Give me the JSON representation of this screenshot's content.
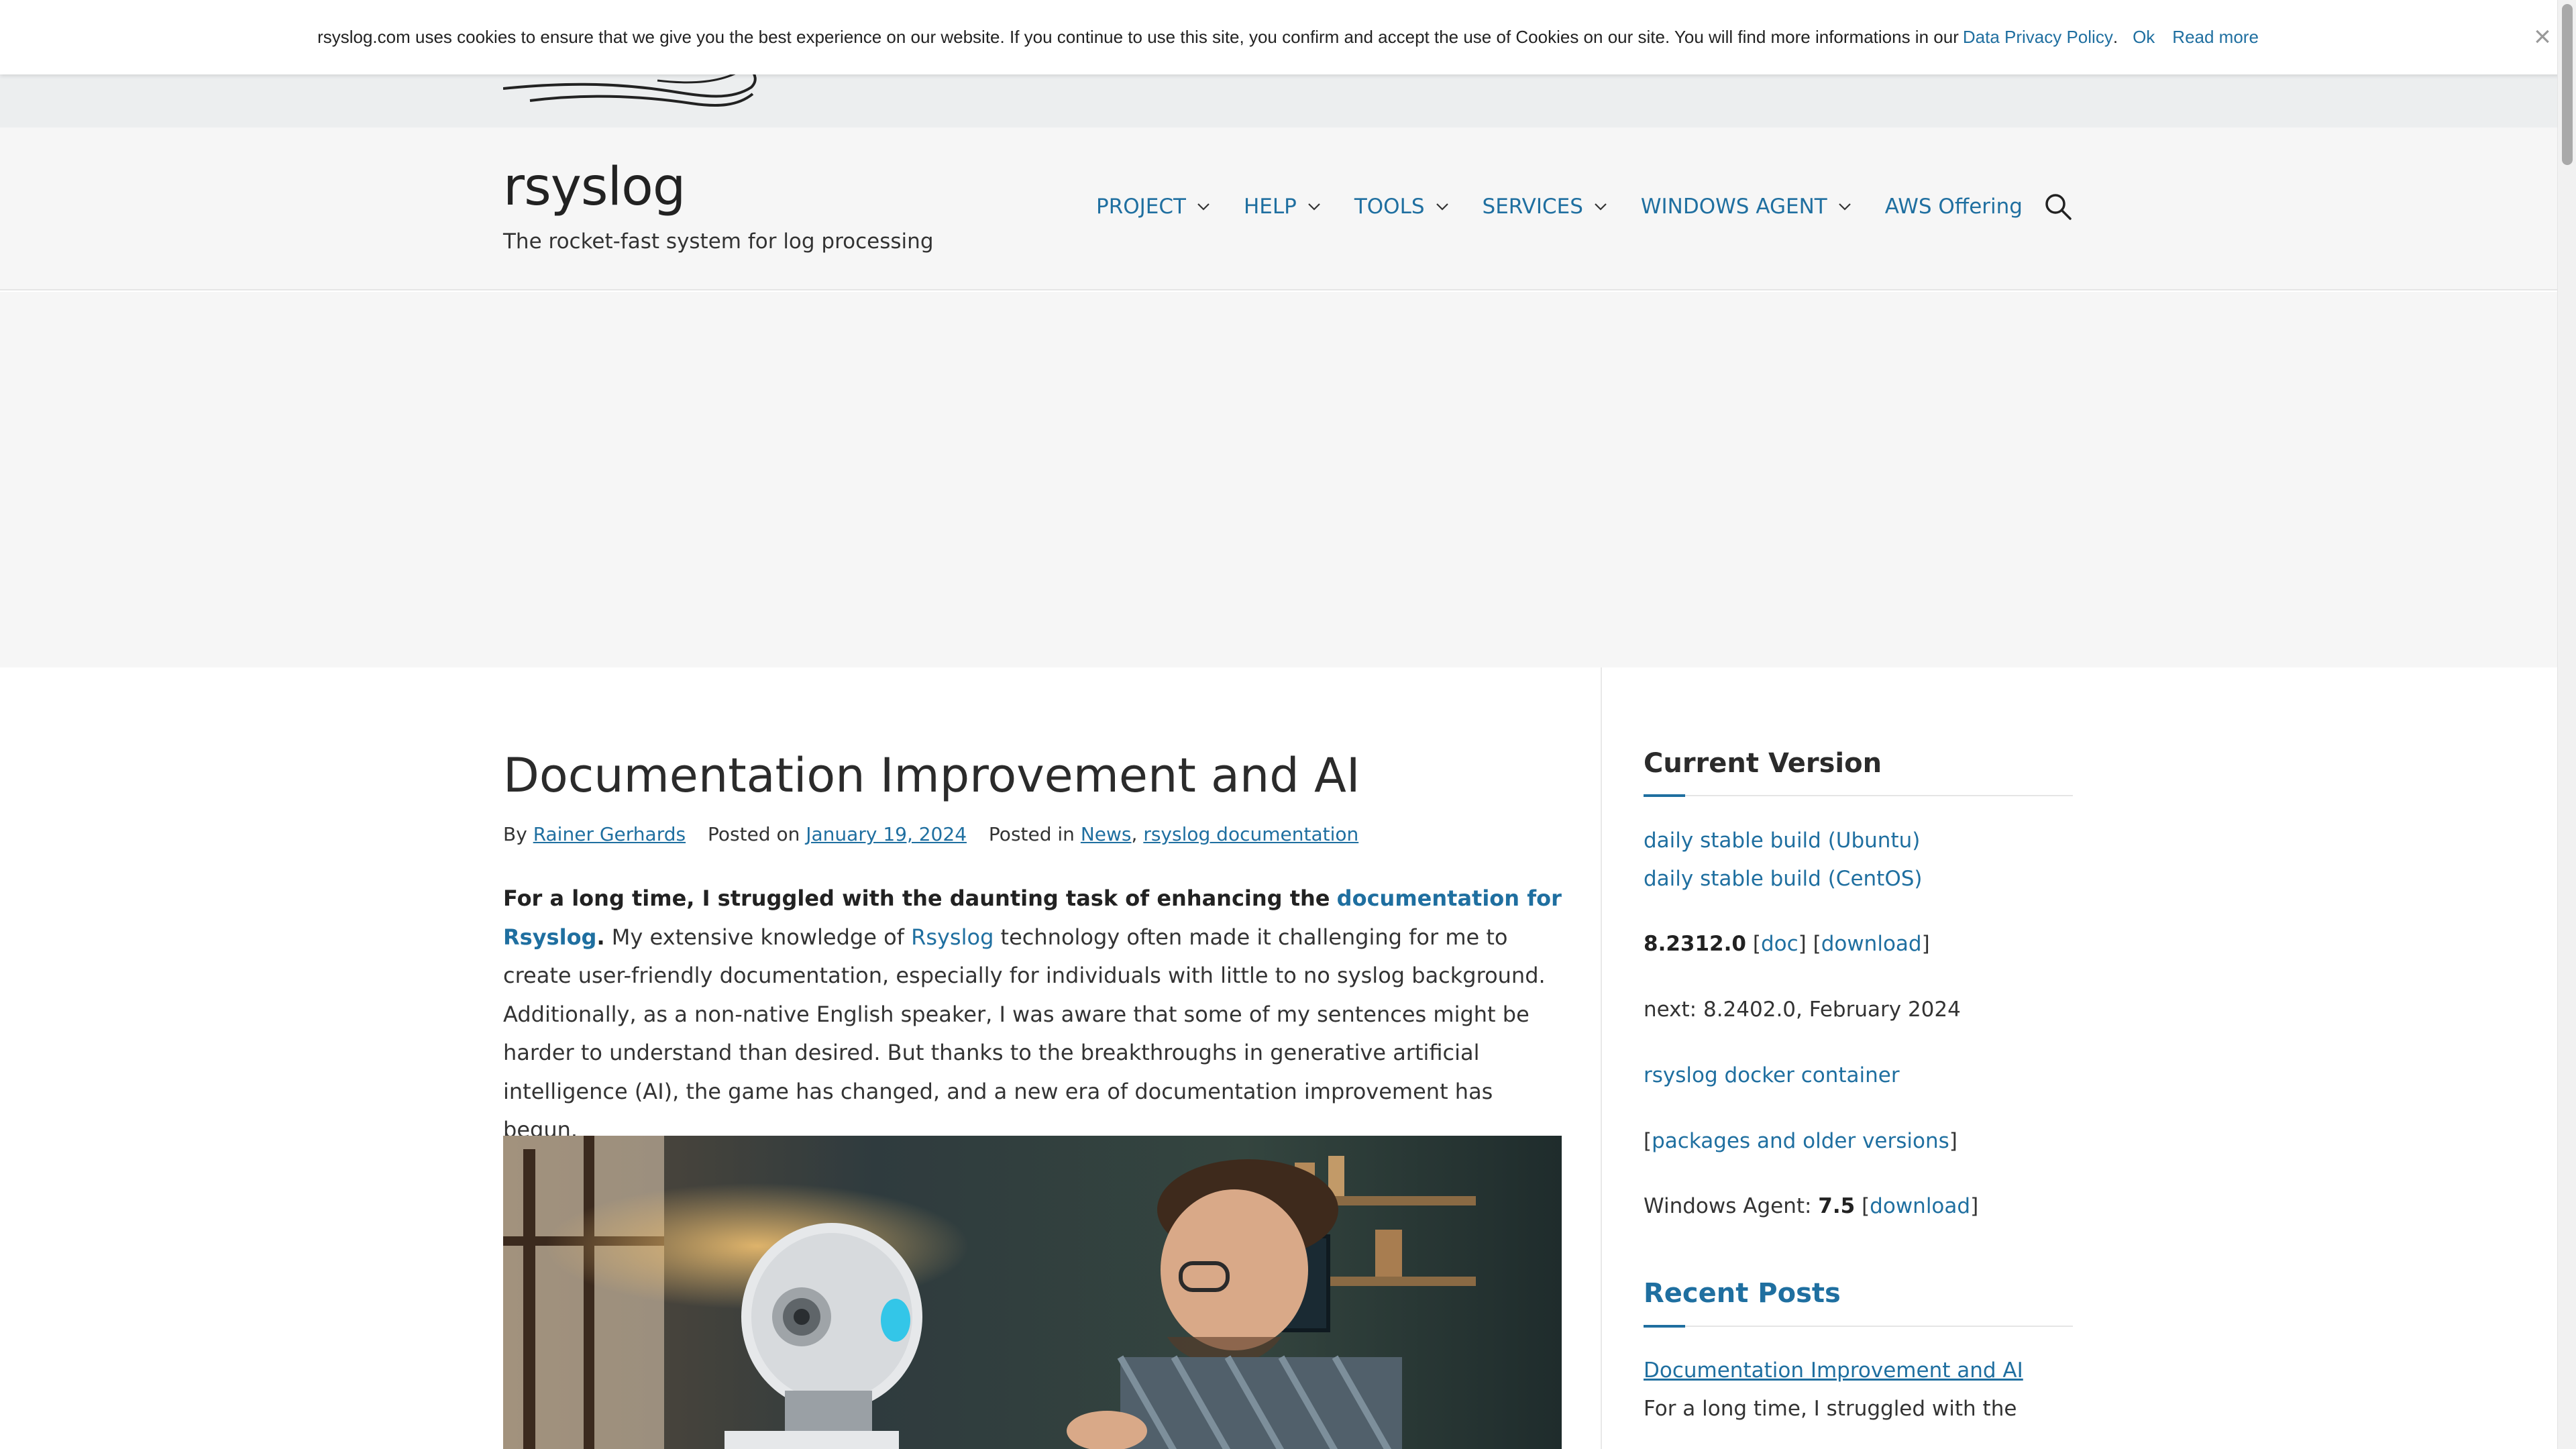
{
  "cookie_bar": {
    "message": "rsyslog.com uses cookies to ensure that we give you the best experience on our website. If you continue to use this site, you confirm and accept the use of Cookies on our site. You will find more informations in our",
    "privacy_link": "Data Privacy Policy",
    "period": ".",
    "ok_label": "Ok",
    "read_more_label": "Read more",
    "close_glyph": "×"
  },
  "header": {
    "site_title": "rsyslog",
    "tagline": "The rocket-fast system for log processing",
    "nav": [
      {
        "label": "PROJECT",
        "has_dropdown": true
      },
      {
        "label": "HELP",
        "has_dropdown": true
      },
      {
        "label": "TOOLS",
        "has_dropdown": true
      },
      {
        "label": "SERVICES",
        "has_dropdown": true
      },
      {
        "label": "WINDOWS AGENT",
        "has_dropdown": true
      },
      {
        "label": "AWS Offering",
        "has_dropdown": false
      }
    ],
    "search_icon": "search-icon"
  },
  "post": {
    "title": "Documentation Improvement and AI",
    "meta": {
      "by_label": "By",
      "author": "Rainer Gerhards",
      "posted_on_label": "Posted on",
      "date": "January 19, 2024",
      "posted_in_label": "Posted in",
      "category_1": "News",
      "separator": ",",
      "category_2": "rsyslog documentation"
    },
    "body": {
      "lead_bold": "For a long time, I struggled with the daunting task of enhancing the",
      "doc_link": "documentation for Rsyslog",
      "lead_period": ".",
      "part_1": "My extensive knowledge of",
      "rsyslog_link": "Rsyslog",
      "part_2": "technology often made it challenging for me to create user-friendly documentation, especially for individuals with little to no syslog background. Additionally, as a non-native English speaker, I was aware that some of my sentences might be harder to understand than desired. But thanks to the breakthroughs in generative artificial intelligence (AI), the game has changed, and a new era of documentation improvement has begun."
    }
  },
  "sidebar": {
    "current_version": {
      "title": "Current Version",
      "ubuntu_link": "daily stable build (Ubuntu)",
      "centos_link": "daily stable build (CentOS)",
      "version": "8.2312.0",
      "doc_link": "doc",
      "download_link": "download",
      "next": "next: 8.2402.0, February 2024",
      "docker_link": "rsyslog docker container",
      "packages_link": "packages and older versions",
      "windows_agent_label": "Windows Agent:",
      "windows_agent_version": "7.5",
      "windows_download_link": "download"
    },
    "recent_posts": {
      "title": "Recent Posts",
      "first_post_link": "Documentation Improvement and AI",
      "first_post_excerpt": "For a long time, I struggled with the"
    }
  },
  "colors": {
    "link": "#1f6fa0",
    "header_bg": "#f6f6f6",
    "text": "#333333"
  }
}
